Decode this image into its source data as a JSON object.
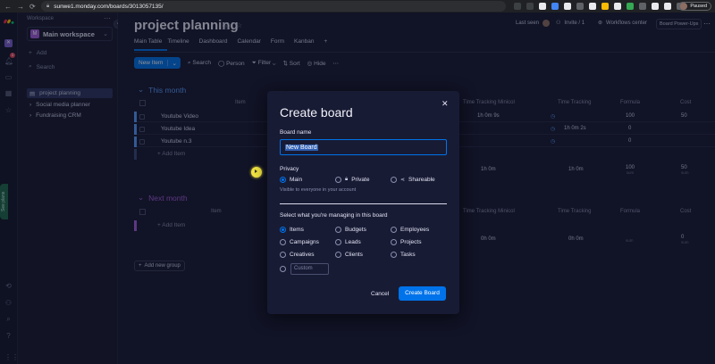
{
  "browser": {
    "url": "sunwe1.monday.com/boards/3013057135/",
    "profile": "Paused"
  },
  "sidebar": {
    "workspace_label": "Workspace",
    "workspace_name": "Main workspace",
    "workspace_initial": "M",
    "add_label": "Add",
    "search_label": "Search",
    "boards": [
      {
        "label": "project planning"
      },
      {
        "label": "Social media planner"
      },
      {
        "label": "Fundraising CRM"
      }
    ],
    "see_plans": "See plans",
    "notification_count": "1"
  },
  "board": {
    "title": "project planning",
    "last_seen": "Last seen",
    "invite": "Invite / 1",
    "workflows": "Workflows center",
    "powerups": "Board Power-Ups",
    "tabs": [
      "Main Table",
      "Timeline",
      "Dashboard",
      "Calendar",
      "Form",
      "Kanban"
    ],
    "toolbar": {
      "new_item": "New Item",
      "search": "Search",
      "person": "Person",
      "filter": "Filter",
      "sort": "Sort",
      "hide": "Hide"
    },
    "groups": [
      {
        "name": "This month",
        "columns": [
          "Item",
          "Time Tracking Minicol",
          "Time Tracking",
          "Formula",
          "Cost"
        ],
        "items": [
          {
            "name": "Youtube Video",
            "time_minicol": "1h 0m 9s",
            "time_tracking": "",
            "formula": "100",
            "cost": "50"
          },
          {
            "name": "Youtube Idea",
            "time_minicol": "",
            "time_tracking": "1h 0m 2s",
            "formula": "0",
            "cost": ""
          },
          {
            "name": "Youtube n.3",
            "time_minicol": "",
            "time_tracking": "",
            "formula": "0",
            "cost": ""
          }
        ],
        "add_item": "+ Add Item",
        "summary": {
          "time_minicol": "1h 0m",
          "time_tracking": "1h 0m",
          "formula": "100",
          "formula_sub": "sum",
          "cost": "50",
          "cost_sub": "sum"
        }
      },
      {
        "name": "Next month",
        "columns": [
          "Item",
          "Time Tracking Minicol",
          "Time Tracking",
          "Formula",
          "Cost"
        ],
        "items": [],
        "add_item": "+ Add Item",
        "summary": {
          "time_minicol": "0h 0m",
          "time_tracking": "0h 0m",
          "formula": "",
          "formula_sub": "sum",
          "cost": "0",
          "cost_sub": "sum"
        }
      }
    ],
    "add_group": "Add new group"
  },
  "dialog": {
    "title": "Create board",
    "name_label": "Board name",
    "name_value": "New Board",
    "privacy_label": "Privacy",
    "privacy_options": [
      "Main",
      "Private",
      "Shareable"
    ],
    "privacy_selected": "Main",
    "privacy_note": "Visible to everyone in your account",
    "manage_label": "Select what you're managing in this board",
    "manage_options": [
      "Items",
      "Budgets",
      "Employees",
      "Campaigns",
      "Leads",
      "Projects",
      "Creatives",
      "Clients",
      "Tasks"
    ],
    "manage_selected": "Items",
    "custom_placeholder": "Custom",
    "cancel": "Cancel",
    "create": "Create Board"
  },
  "colors": {
    "accent": "#0073ea",
    "group_blue": "#579bfc",
    "group_purple": "#a25ddc",
    "dialog_bg": "#181b34",
    "page_bg": "#181b34"
  }
}
